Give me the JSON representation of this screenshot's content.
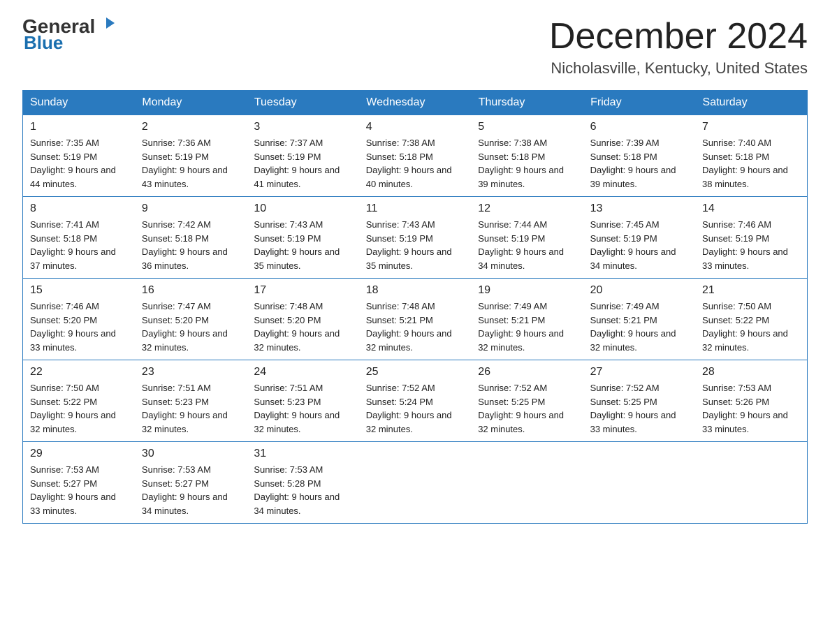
{
  "header": {
    "logo_general": "General",
    "logo_blue": "Blue",
    "month_title": "December 2024",
    "location": "Nicholasville, Kentucky, United States"
  },
  "days_of_week": [
    "Sunday",
    "Monday",
    "Tuesday",
    "Wednesday",
    "Thursday",
    "Friday",
    "Saturday"
  ],
  "weeks": [
    [
      {
        "day": "1",
        "sunrise": "7:35 AM",
        "sunset": "5:19 PM",
        "daylight": "9 hours and 44 minutes."
      },
      {
        "day": "2",
        "sunrise": "7:36 AM",
        "sunset": "5:19 PM",
        "daylight": "9 hours and 43 minutes."
      },
      {
        "day": "3",
        "sunrise": "7:37 AM",
        "sunset": "5:19 PM",
        "daylight": "9 hours and 41 minutes."
      },
      {
        "day": "4",
        "sunrise": "7:38 AM",
        "sunset": "5:18 PM",
        "daylight": "9 hours and 40 minutes."
      },
      {
        "day": "5",
        "sunrise": "7:38 AM",
        "sunset": "5:18 PM",
        "daylight": "9 hours and 39 minutes."
      },
      {
        "day": "6",
        "sunrise": "7:39 AM",
        "sunset": "5:18 PM",
        "daylight": "9 hours and 39 minutes."
      },
      {
        "day": "7",
        "sunrise": "7:40 AM",
        "sunset": "5:18 PM",
        "daylight": "9 hours and 38 minutes."
      }
    ],
    [
      {
        "day": "8",
        "sunrise": "7:41 AM",
        "sunset": "5:18 PM",
        "daylight": "9 hours and 37 minutes."
      },
      {
        "day": "9",
        "sunrise": "7:42 AM",
        "sunset": "5:18 PM",
        "daylight": "9 hours and 36 minutes."
      },
      {
        "day": "10",
        "sunrise": "7:43 AM",
        "sunset": "5:19 PM",
        "daylight": "9 hours and 35 minutes."
      },
      {
        "day": "11",
        "sunrise": "7:43 AM",
        "sunset": "5:19 PM",
        "daylight": "9 hours and 35 minutes."
      },
      {
        "day": "12",
        "sunrise": "7:44 AM",
        "sunset": "5:19 PM",
        "daylight": "9 hours and 34 minutes."
      },
      {
        "day": "13",
        "sunrise": "7:45 AM",
        "sunset": "5:19 PM",
        "daylight": "9 hours and 34 minutes."
      },
      {
        "day": "14",
        "sunrise": "7:46 AM",
        "sunset": "5:19 PM",
        "daylight": "9 hours and 33 minutes."
      }
    ],
    [
      {
        "day": "15",
        "sunrise": "7:46 AM",
        "sunset": "5:20 PM",
        "daylight": "9 hours and 33 minutes."
      },
      {
        "day": "16",
        "sunrise": "7:47 AM",
        "sunset": "5:20 PM",
        "daylight": "9 hours and 32 minutes."
      },
      {
        "day": "17",
        "sunrise": "7:48 AM",
        "sunset": "5:20 PM",
        "daylight": "9 hours and 32 minutes."
      },
      {
        "day": "18",
        "sunrise": "7:48 AM",
        "sunset": "5:21 PM",
        "daylight": "9 hours and 32 minutes."
      },
      {
        "day": "19",
        "sunrise": "7:49 AM",
        "sunset": "5:21 PM",
        "daylight": "9 hours and 32 minutes."
      },
      {
        "day": "20",
        "sunrise": "7:49 AM",
        "sunset": "5:21 PM",
        "daylight": "9 hours and 32 minutes."
      },
      {
        "day": "21",
        "sunrise": "7:50 AM",
        "sunset": "5:22 PM",
        "daylight": "9 hours and 32 minutes."
      }
    ],
    [
      {
        "day": "22",
        "sunrise": "7:50 AM",
        "sunset": "5:22 PM",
        "daylight": "9 hours and 32 minutes."
      },
      {
        "day": "23",
        "sunrise": "7:51 AM",
        "sunset": "5:23 PM",
        "daylight": "9 hours and 32 minutes."
      },
      {
        "day": "24",
        "sunrise": "7:51 AM",
        "sunset": "5:23 PM",
        "daylight": "9 hours and 32 minutes."
      },
      {
        "day": "25",
        "sunrise": "7:52 AM",
        "sunset": "5:24 PM",
        "daylight": "9 hours and 32 minutes."
      },
      {
        "day": "26",
        "sunrise": "7:52 AM",
        "sunset": "5:25 PM",
        "daylight": "9 hours and 32 minutes."
      },
      {
        "day": "27",
        "sunrise": "7:52 AM",
        "sunset": "5:25 PM",
        "daylight": "9 hours and 33 minutes."
      },
      {
        "day": "28",
        "sunrise": "7:53 AM",
        "sunset": "5:26 PM",
        "daylight": "9 hours and 33 minutes."
      }
    ],
    [
      {
        "day": "29",
        "sunrise": "7:53 AM",
        "sunset": "5:27 PM",
        "daylight": "9 hours and 33 minutes."
      },
      {
        "day": "30",
        "sunrise": "7:53 AM",
        "sunset": "5:27 PM",
        "daylight": "9 hours and 34 minutes."
      },
      {
        "day": "31",
        "sunrise": "7:53 AM",
        "sunset": "5:28 PM",
        "daylight": "9 hours and 34 minutes."
      },
      null,
      null,
      null,
      null
    ]
  ]
}
